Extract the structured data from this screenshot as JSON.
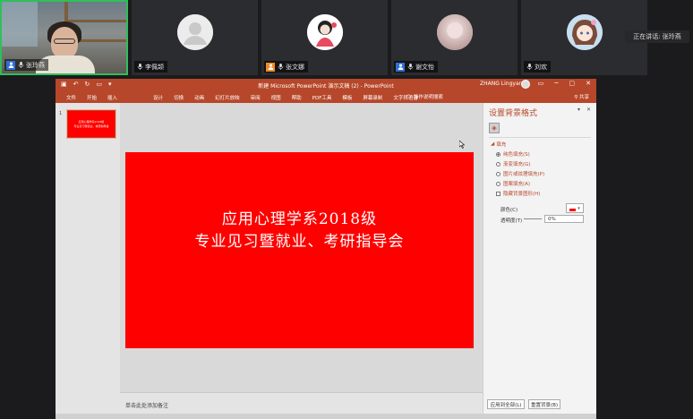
{
  "participants": [
    {
      "name": "张玲燕",
      "badge": "host",
      "muted": true
    },
    {
      "name": "李佩颉",
      "muted": true
    },
    {
      "name": "张文娜",
      "badge": "co-host",
      "muted": true
    },
    {
      "name": "谢文怡",
      "badge": "user",
      "muted": true
    },
    {
      "name": "刘欢",
      "muted": true
    }
  ],
  "speaking": "正在讲话: 张玲燕",
  "ppt": {
    "title": "新建 Microsoft PowerPoint 演示文稿 (2)  -  PowerPoint",
    "user": "ZHANG Lingyan",
    "tabs": [
      "文件",
      "开始",
      "插入",
      "设计",
      "切换",
      "动画",
      "幻灯片放映",
      "审阅",
      "视图",
      "帮助",
      "PDF工具",
      "模板",
      "屏幕录制",
      "文字转语音"
    ],
    "tell_me": "操作说明搜索",
    "share": "共享",
    "slide_number": "1",
    "slide": {
      "line1": "应用心理学系2018级",
      "line2": "专业见习暨就业、考研指导会"
    },
    "notes_placeholder": "单击此处添加备注",
    "format_pane": {
      "title": "设置背景格式",
      "section": "填充",
      "options": [
        "纯色填充(S)",
        "渐变填充(G)",
        "图片或纹理填充(P)",
        "图案填充(A)",
        "隐藏背景图形(H)"
      ],
      "selected": "纯色填充(S)",
      "color_label": "颜色(C)",
      "transparency_label": "透明度(T)",
      "transparency_value": "0%",
      "apply_all": "应用到全部(L)",
      "reset": "重置背景(B)"
    }
  },
  "colors": {
    "ppt_accent": "#b7472a",
    "slide_bg": "#ff0000",
    "speaker_border": "#2fbf5b"
  }
}
